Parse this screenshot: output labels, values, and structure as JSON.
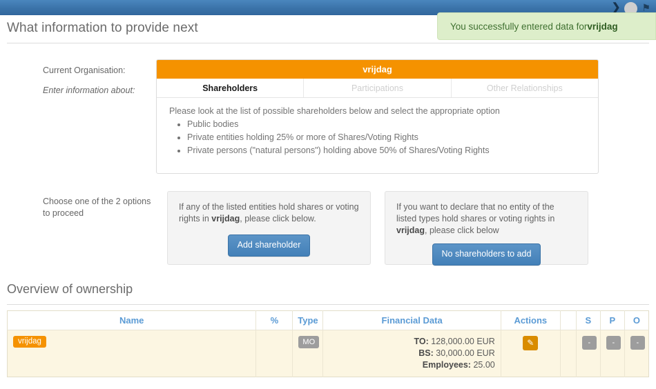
{
  "topbar": {
    "icons": [
      {
        "name": "chevron-right-icon",
        "glyph": "❯"
      },
      {
        "name": "avatar",
        "glyph": ""
      },
      {
        "name": "flag-icon",
        "glyph": "⚑"
      }
    ]
  },
  "notification": {
    "prefix": "You successfully entered data for ",
    "org": "vrijdag"
  },
  "header": {
    "title": "What information to provide next"
  },
  "labels": {
    "current_organisation": "Current Organisation:",
    "enter_information_about": "Enter information about:",
    "choose_options": "Choose one of the 2 options to proceed"
  },
  "panel": {
    "org_name": "vrijdag",
    "tabs": [
      {
        "label": "Shareholders",
        "state": "active"
      },
      {
        "label": "Participations",
        "state": "disabled"
      },
      {
        "label": "Other Relationships",
        "state": "disabled"
      }
    ],
    "intro": "Please look at the list of possible shareholders below and select the appropriate option",
    "bullets": [
      "Public bodies",
      "Private entities holding 25% or more of Shares/Voting Rights",
      "Private persons (\"natural persons\") holding above 50% of Shares/Voting Rights"
    ]
  },
  "options": {
    "box1": {
      "text_before": "If any of the listed entities hold shares or voting rights in ",
      "org": "vrijdag",
      "text_after": ", please click below.",
      "button": "Add shareholder"
    },
    "box2": {
      "text_before": "If you want to declare that no entity of the listed types hold shares or voting rights in ",
      "org": "vrijdag",
      "text_after": ", please click below",
      "button": "No shareholders to add"
    }
  },
  "overview": {
    "title": "Overview of ownership",
    "columns": [
      "Name",
      "%",
      "Type",
      "Financial Data",
      "Actions",
      "",
      "S",
      "P",
      "O"
    ],
    "rows": [
      {
        "name": "vrijdag",
        "percent": "",
        "type": "MO",
        "financial": {
          "turnover_label": "TO:",
          "turnover_value": "128,000.00 EUR",
          "balance_label": "BS:",
          "balance_value": "30,000.00 EUR",
          "employees_label": "Employees:",
          "employees_value": "25.00"
        },
        "action_icon": "edit-icon",
        "s": "-",
        "p": "-",
        "o": "-"
      }
    ]
  },
  "colors": {
    "topbar_blue": "#3a72a8",
    "orange": "#f59200",
    "notice_green_bg": "#ddeeca",
    "notice_green_text": "#3f7030",
    "table_header_blue": "#5b9bd5",
    "row_cream": "#fcf6e2",
    "button_blue": "#4380b8",
    "edit_orange": "#d98c00",
    "gray_badge": "#9d9d9d"
  }
}
